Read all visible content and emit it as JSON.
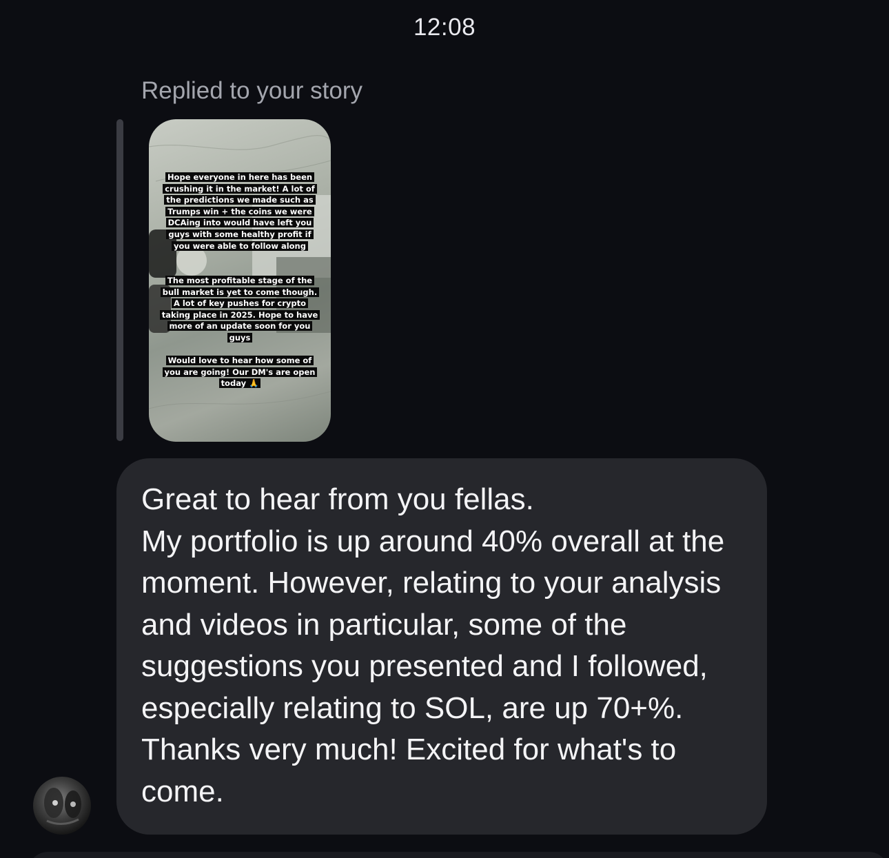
{
  "thread": {
    "timestamp": "12:08",
    "reply_label": "Replied to your story"
  },
  "story": {
    "paragraph1": "Hope everyone in here has been crushing it in the market! A lot of the predictions we made such as Trumps win + the coins we were DCAing into would have left you guys with some healthy profit if you were able to follow along",
    "paragraph2": "The most profitable stage of the bull market is yet to come though. A lot of key pushes for crypto taking place in 2025. Hope to have more of an update soon for you guys",
    "paragraph3": "Would love to hear how some of you are going! Our DM's are open today 🙏"
  },
  "message": {
    "text": "Great to hear from you fellas.\nMy portfolio is up around 40% overall at the moment. However, relating to your analysis and videos in particular, some of the suggestions you presented and I followed, especially relating to SOL, are up 70+%. Thanks very much! Excited for what's to come."
  },
  "colors": {
    "background": "#0c0d12",
    "bubble": "#26272c",
    "reply_bar": "#3b3c43",
    "secondary_text": "#a4a6ae",
    "primary_text": "#f4f4f6"
  },
  "icons": {
    "avatar": "sender-avatar"
  }
}
